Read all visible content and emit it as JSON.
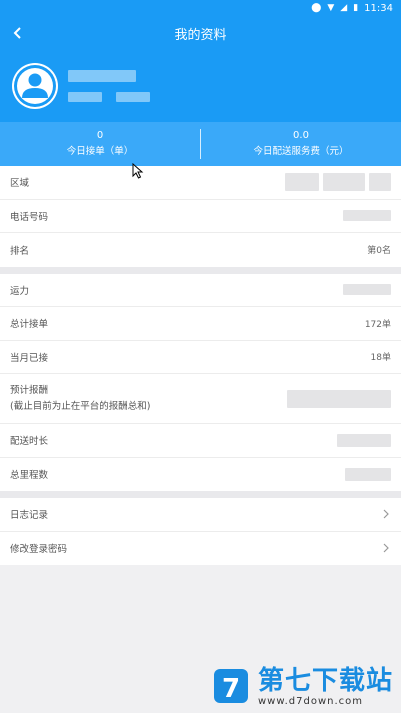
{
  "status_bar": {
    "time": "11:34",
    "icons": [
      "location-icon",
      "wifi-icon",
      "signal-icon",
      "battery-icon"
    ]
  },
  "header": {
    "title": "我的资料",
    "back_icon": "chevron-left-icon"
  },
  "profile": {
    "avatar_icon": "user-avatar-icon"
  },
  "stats": [
    {
      "value": "0",
      "label": "今日接单（单）"
    },
    {
      "value": "0.0",
      "label": "今日配送服务费（元）"
    }
  ],
  "section1": [
    {
      "label": "区域"
    },
    {
      "label": "电话号码"
    },
    {
      "label": "排名",
      "value": "第0名"
    }
  ],
  "section2": [
    {
      "label": "运力"
    },
    {
      "label": "总计接单",
      "value": "172单"
    },
    {
      "label": "当月已接",
      "value": "18单"
    },
    {
      "label_line1": "预计报酬",
      "label_line2": "(截止目前为止在平台的报酬总和)"
    },
    {
      "label": "配送时长"
    },
    {
      "label": "总里程数"
    }
  ],
  "section3": [
    {
      "label": "日志记录",
      "icon": "chevron-right-icon"
    },
    {
      "label": "修改登录密码",
      "icon": "chevron-right-icon"
    }
  ],
  "watermark": {
    "cn": "第七下载站",
    "url": "www.d7down.com"
  },
  "colors": {
    "primary": "#1a9bf5",
    "stats_bg": "#3aa9f9",
    "background": "#f0f0f2"
  }
}
